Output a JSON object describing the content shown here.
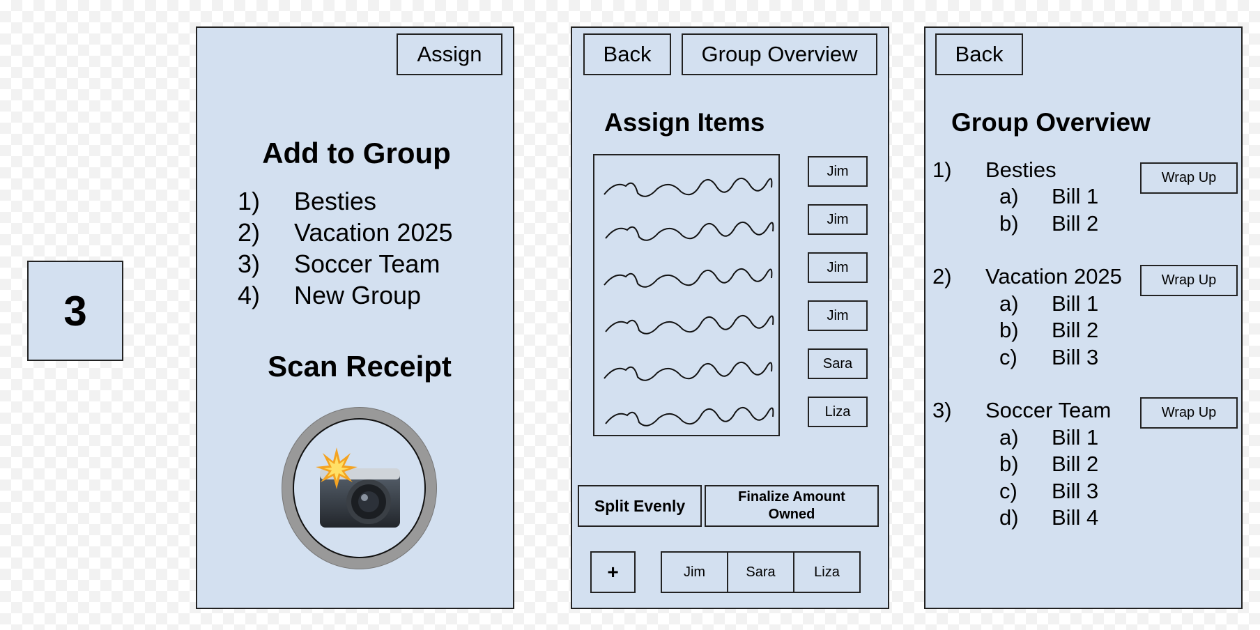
{
  "step_badge": {
    "label": "3"
  },
  "screen1": {
    "assign_button": "Assign",
    "title": "Add to Group",
    "groups": [
      {
        "num": "1)",
        "name": "Besties"
      },
      {
        "num": "2)",
        "name": "Vacation 2025"
      },
      {
        "num": "3)",
        "name": "Soccer Team"
      },
      {
        "num": "4)",
        "name": "New Group"
      }
    ],
    "scan_title": "Scan Receipt",
    "camera_icon": "camera-with-flash-icon"
  },
  "screen2": {
    "back_button": "Back",
    "overview_button": "Group Overview",
    "title": "Assign Items",
    "receipt_icon": "receipt-squiggle-lines",
    "item_assignees": [
      "Jim",
      "Jim",
      "Jim",
      "Jim",
      "Sara",
      "Liza"
    ],
    "split_evenly": "Split Evenly",
    "finalize_line1": "Finalize Amount",
    "finalize_line2": "Owned",
    "add_button": "+",
    "members": [
      "Jim",
      "Sara",
      "Liza"
    ]
  },
  "screen3": {
    "back_button": "Back",
    "title": "Group Overview",
    "groups": [
      {
        "num": "1)",
        "name": "Besties",
        "wrap_label": "Wrap Up",
        "bills": [
          {
            "letter": "a)",
            "name": "Bill 1"
          },
          {
            "letter": "b)",
            "name": "Bill 2"
          }
        ]
      },
      {
        "num": "2)",
        "name": "Vacation 2025",
        "wrap_label": "Wrap Up",
        "bills": [
          {
            "letter": "a)",
            "name": "Bill 1"
          },
          {
            "letter": "b)",
            "name": "Bill 2"
          },
          {
            "letter": "c)",
            "name": "Bill 3"
          }
        ]
      },
      {
        "num": "3)",
        "name": "Soccer Team",
        "wrap_label": "Wrap Up",
        "bills": [
          {
            "letter": "a)",
            "name": "Bill 1"
          },
          {
            "letter": "b)",
            "name": "Bill 2"
          },
          {
            "letter": "c)",
            "name": "Bill 3"
          },
          {
            "letter": "d)",
            "name": "Bill 4"
          }
        ]
      }
    ]
  }
}
